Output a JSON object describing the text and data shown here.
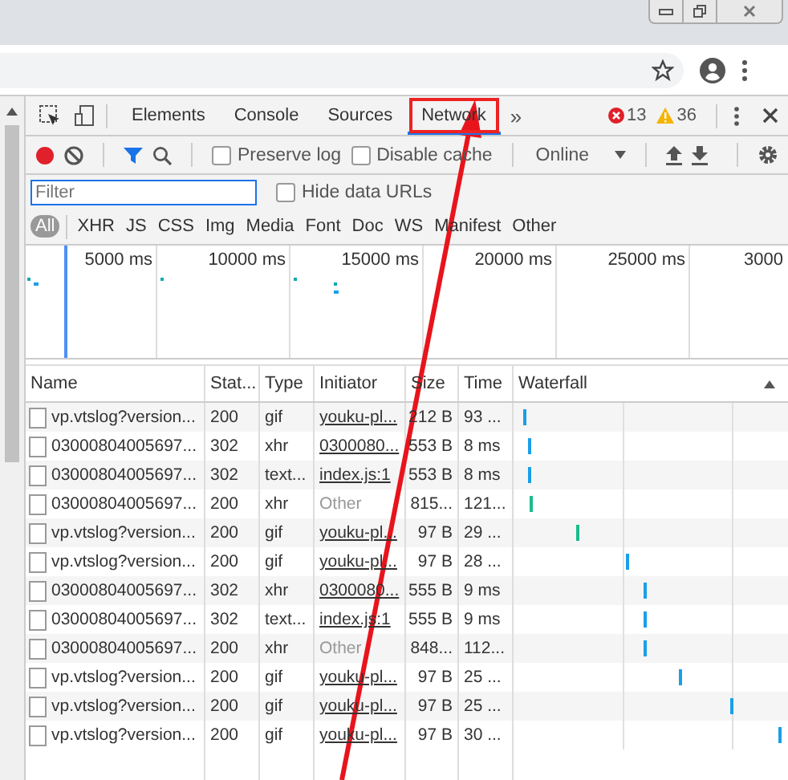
{
  "devtools": {
    "tabs": [
      {
        "label": "Elements",
        "selected": false
      },
      {
        "label": "Console",
        "selected": false
      },
      {
        "label": "Sources",
        "selected": false
      },
      {
        "label": "Network",
        "selected": true,
        "highlighted": true
      }
    ],
    "more_tabs": "»",
    "errors": "13",
    "warnings": "36"
  },
  "network_toolbar": {
    "recording": true,
    "filter_on": true,
    "checkboxes": [
      {
        "label": "Preserve log",
        "checked": false
      },
      {
        "label": "Disable cache",
        "checked": false
      }
    ],
    "throttling": "Online"
  },
  "filter_bar": {
    "placeholder": "Filter",
    "hide_data_urls": {
      "label": "Hide data URLs",
      "checked": false
    }
  },
  "type_filters": [
    {
      "label": "All",
      "selected": true
    },
    {
      "label": "XHR",
      "selected": false
    },
    {
      "label": "JS",
      "selected": false
    },
    {
      "label": "CSS",
      "selected": false
    },
    {
      "label": "Img",
      "selected": false
    },
    {
      "label": "Media",
      "selected": false
    },
    {
      "label": "Font",
      "selected": false
    },
    {
      "label": "Doc",
      "selected": false
    },
    {
      "label": "WS",
      "selected": false
    },
    {
      "label": "Manifest",
      "selected": false
    },
    {
      "label": "Other",
      "selected": false
    }
  ],
  "overview_ticks": [
    "5000 ms",
    "10000 ms",
    "15000 ms",
    "20000 ms",
    "25000 ms",
    "3000"
  ],
  "table": {
    "columns": [
      "Name",
      "Stat...",
      "Type",
      "Initiator",
      "Size",
      "Time",
      "Waterfall"
    ],
    "rows": [
      {
        "name": "vp.vtslog?version...",
        "status": "200",
        "type": "gif",
        "initiator": "youku-pl...",
        "initiator_link": true,
        "size": "212 B",
        "time": "93 ...",
        "level": 0.02,
        "color": "#1a9fe8"
      },
      {
        "name": "03000804005697...",
        "status": "302",
        "type": "xhr",
        "initiator": "0300080...",
        "initiator_link": true,
        "size": "553 B",
        "time": "8 ms",
        "level": 0.035,
        "color": "#1a9fe8"
      },
      {
        "name": "03000804005697...",
        "status": "302",
        "type": "text...",
        "initiator": "index.js:1",
        "initiator_link": true,
        "size": "553 B",
        "time": "8 ms",
        "level": 0.035,
        "color": "#1a9fe8"
      },
      {
        "name": "03000804005697...",
        "status": "200",
        "type": "xhr",
        "initiator": "Other",
        "initiator_link": false,
        "size": "815...",
        "time": "121...",
        "level": 0.04,
        "color": "#1abc8c"
      },
      {
        "name": "vp.vtslog?version...",
        "status": "200",
        "type": "gif",
        "initiator": "youku-pl...",
        "initiator_link": true,
        "size": "97 B",
        "time": "29 ...",
        "level": 0.22,
        "color": "#1abc8c"
      },
      {
        "name": "vp.vtslog?version...",
        "status": "200",
        "type": "gif",
        "initiator": "youku-pl...",
        "initiator_link": true,
        "size": "97 B",
        "time": "28 ...",
        "level": 0.41,
        "color": "#1a9fe8"
      },
      {
        "name": "03000804005697...",
        "status": "302",
        "type": "xhr",
        "initiator": "0300080...",
        "initiator_link": true,
        "size": "555 B",
        "time": "9 ms",
        "level": 0.475,
        "color": "#1a9fe8"
      },
      {
        "name": "03000804005697...",
        "status": "302",
        "type": "text...",
        "initiator": "index.js:1",
        "initiator_link": true,
        "size": "555 B",
        "time": "9 ms",
        "level": 0.475,
        "color": "#1a9fe8"
      },
      {
        "name": "03000804005697...",
        "status": "200",
        "type": "xhr",
        "initiator": "Other",
        "initiator_link": false,
        "size": "848...",
        "time": "112...",
        "level": 0.475,
        "color": "#1a9fe8"
      },
      {
        "name": "vp.vtslog?version...",
        "status": "200",
        "type": "gif",
        "initiator": "youku-pl...",
        "initiator_link": true,
        "size": "97 B",
        "time": "25 ...",
        "level": 0.61,
        "color": "#1a9fe8"
      },
      {
        "name": "vp.vtslog?version...",
        "status": "200",
        "type": "gif",
        "initiator": "youku-pl...",
        "initiator_link": true,
        "size": "97 B",
        "time": "25 ...",
        "level": 0.805,
        "color": "#1a9fe8"
      },
      {
        "name": "vp.vtslog?version...",
        "status": "200",
        "type": "gif",
        "initiator": "youku-pl...",
        "initiator_link": true,
        "size": "97 B",
        "time": "30 ...",
        "level": 0.99,
        "color": "#1a9fe8"
      }
    ]
  }
}
